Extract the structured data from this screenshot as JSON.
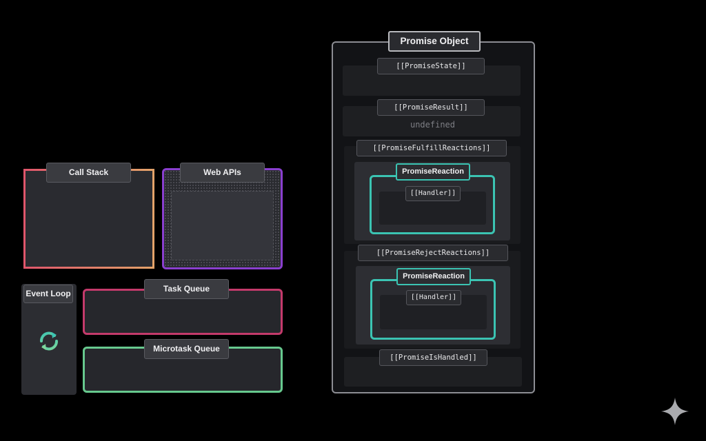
{
  "left": {
    "call_stack": {
      "label": "Call Stack",
      "border_colors": [
        "#e0566b",
        "#e3a36a"
      ]
    },
    "web_apis": {
      "label": "Web APIs",
      "border_color": "#8a3fcf"
    },
    "event_loop": {
      "label": "Event Loop",
      "icon": "refresh-cycle-icon",
      "icon_colors": [
        "#3bc4b3",
        "#7fd79a"
      ]
    },
    "task_queue": {
      "label": "Task Queue",
      "border_color": "#c43a6b"
    },
    "microtask_queue": {
      "label": "Microtask Queue",
      "border_color": "#67c98e"
    }
  },
  "promise": {
    "title": "Promise Object",
    "state": {
      "label": "[[PromiseState]]"
    },
    "result": {
      "label": "[[PromiseResult]]",
      "value": "undefined"
    },
    "fulfill_reactions": {
      "label": "[[PromiseFulfillReactions]]",
      "reaction": {
        "label": "PromiseReaction",
        "handler": "[[Handler]]"
      }
    },
    "reject_reactions": {
      "label": "[[PromiseRejectReactions]]",
      "reaction": {
        "label": "PromiseReaction",
        "handler": "[[Handler]]"
      }
    },
    "is_handled": {
      "label": "[[PromiseIsHandled]]"
    },
    "reaction_color": "#3bc4b3"
  },
  "decor": {
    "corner_icon": "sparkle-icon"
  }
}
